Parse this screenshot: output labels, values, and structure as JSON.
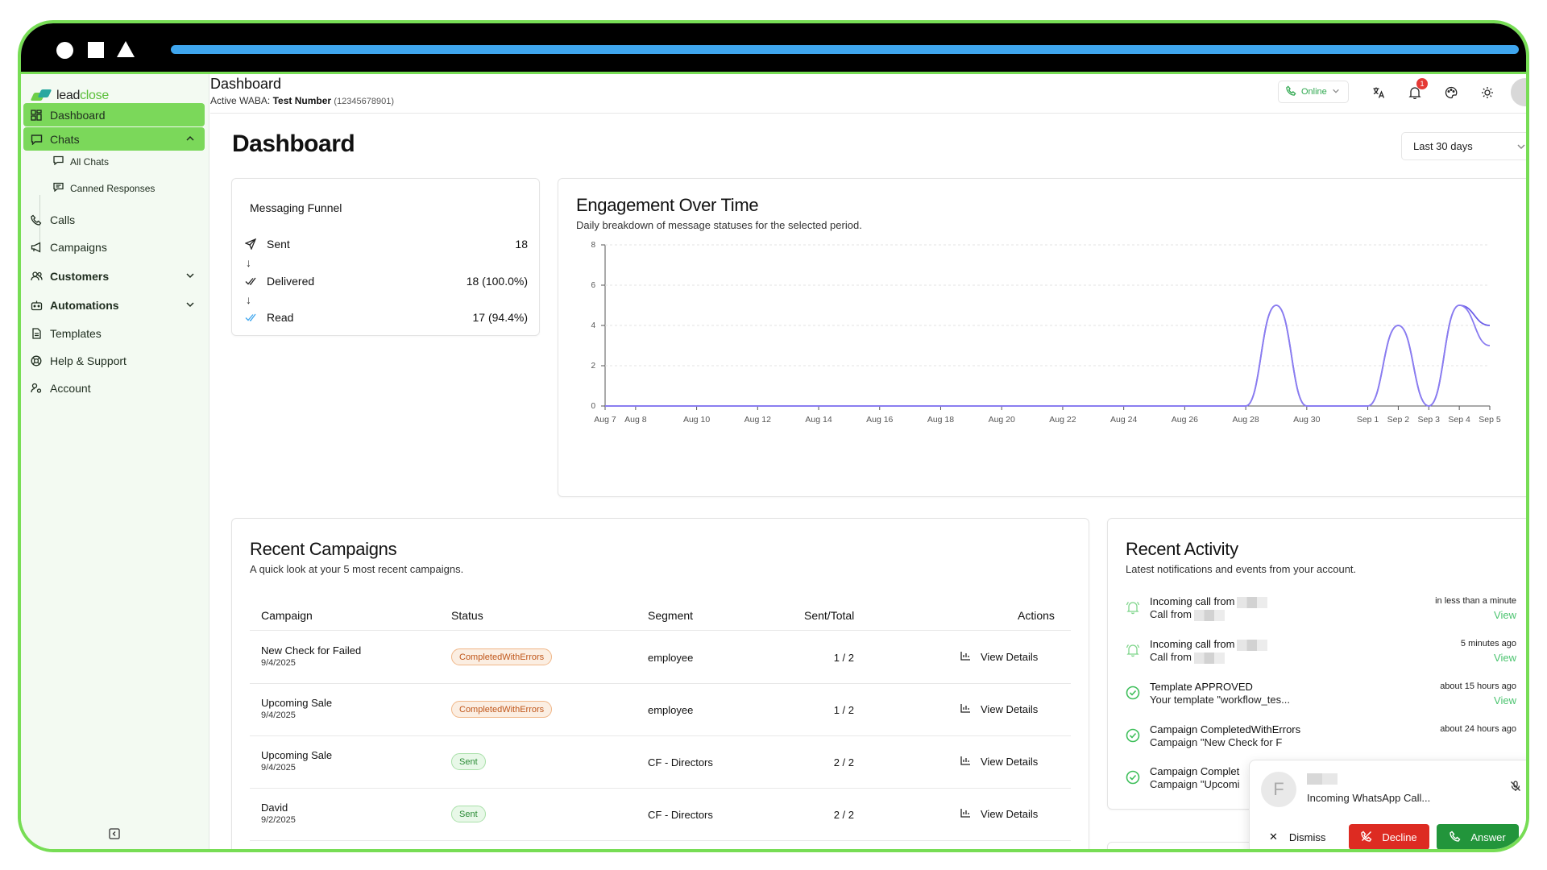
{
  "brand": {
    "name_part1": "lead",
    "name_part2": "close"
  },
  "sidebar": {
    "items": [
      {
        "label": "Dashboard",
        "icon": "dashboard-icon"
      },
      {
        "label": "Chats",
        "icon": "chat-icon"
      },
      {
        "label": "Calls",
        "icon": "phone-icon"
      },
      {
        "label": "Campaigns",
        "icon": "megaphone-icon"
      },
      {
        "label": "Customers",
        "icon": "users-icon"
      },
      {
        "label": "Automations",
        "icon": "bot-icon"
      },
      {
        "label": "Templates",
        "icon": "file-icon"
      },
      {
        "label": "Help & Support",
        "icon": "lifebuoy-icon"
      },
      {
        "label": "Account",
        "icon": "user-cog-icon"
      }
    ],
    "chat_sub": [
      {
        "label": "All Chats",
        "icon": "chat-icon"
      },
      {
        "label": "Canned Responses",
        "icon": "chat-text-icon"
      }
    ]
  },
  "header": {
    "title": "Dashboard",
    "waba_label": "Active WABA:",
    "waba_name": "Test Number",
    "waba_id": "(12345678901)",
    "status": "Online",
    "notifications": "1"
  },
  "page": {
    "title": "Dashboard",
    "range": "Last 30 days"
  },
  "funnel": {
    "title": "Messaging Funnel",
    "rows": [
      {
        "label": "Sent",
        "value": "18"
      },
      {
        "label": "Delivered",
        "value": "18 (100.0%)"
      },
      {
        "label": "Read",
        "value": "17 (94.4%)"
      }
    ]
  },
  "engagement": {
    "title": "Engagement Over Time",
    "subtitle": "Daily breakdown of message statuses for the selected period."
  },
  "chart_data": {
    "type": "line",
    "x": [
      "Aug 7",
      "Aug 8",
      "Aug 10",
      "Aug 12",
      "Aug 14",
      "Aug 16",
      "Aug 18",
      "Aug 20",
      "Aug 22",
      "Aug 24",
      "Aug 26",
      "Aug 28",
      "Aug 30",
      "Sep 1",
      "Sep 2",
      "Sep 3",
      "Sep 4",
      "Sep 5"
    ],
    "series": [
      {
        "color": "#6a5ce8",
        "values": [
          0,
          0,
          0,
          0,
          0,
          0,
          0,
          0,
          0,
          0,
          0,
          0,
          5,
          0,
          0,
          4,
          0,
          5,
          4
        ]
      },
      {
        "color": "#8a7cf0",
        "values": [
          0,
          0,
          0,
          0,
          0,
          0,
          0,
          0,
          0,
          0,
          0,
          0,
          5,
          0,
          0,
          4,
          0,
          5,
          3
        ]
      }
    ],
    "ylim": [
      0,
      8
    ],
    "yticks": [
      0,
      2,
      4,
      6,
      8
    ],
    "grid": true
  },
  "campaigns": {
    "title": "Recent Campaigns",
    "subtitle": "A quick look at your 5 most recent campaigns.",
    "columns": [
      "Campaign",
      "Status",
      "Segment",
      "Sent/Total",
      "Actions"
    ],
    "rows": [
      {
        "name": "New Check for Failed",
        "date": "9/4/2025",
        "status": "CompletedWithErrors",
        "segment": "employee",
        "sent": "1 / 2",
        "action": "View Details"
      },
      {
        "name": "Upcoming Sale",
        "date": "9/4/2025",
        "status": "CompletedWithErrors",
        "segment": "employee",
        "sent": "1 / 2",
        "action": "View Details"
      },
      {
        "name": "Upcoming Sale",
        "date": "9/4/2025",
        "status": "Sent",
        "segment": "CF - Directors",
        "sent": "2 / 2",
        "action": "View Details"
      },
      {
        "name": "David",
        "date": "9/2/2025",
        "status": "Sent",
        "segment": "CF - Directors",
        "sent": "2 / 2",
        "action": "View Details"
      }
    ]
  },
  "activity": {
    "title": "Recent Activity",
    "subtitle": "Latest notifications and events from your account.",
    "items": [
      {
        "title": "Incoming call from",
        "detail": "Call from",
        "time": "in less than a minute",
        "view": "View"
      },
      {
        "title": "Incoming call from",
        "detail": "Call from",
        "time": "5 minutes ago",
        "view": "View"
      },
      {
        "title": "Template APPROVED",
        "detail": "Your template \"workflow_tes...",
        "time": "about 15 hours ago",
        "view": "View"
      },
      {
        "title": "Campaign CompletedWithErrors",
        "detail": "Campaign \"New Check for F",
        "time": "about 24 hours ago",
        "view": ""
      },
      {
        "title": "Campaign Complet",
        "detail": "Campaign \"Upcomi",
        "time": "",
        "view": ""
      }
    ]
  },
  "call_popup": {
    "avatar_letter": "F",
    "subtitle": "Incoming WhatsApp Call...",
    "dismiss": "Dismiss",
    "decline": "Decline",
    "answer": "Answer"
  }
}
